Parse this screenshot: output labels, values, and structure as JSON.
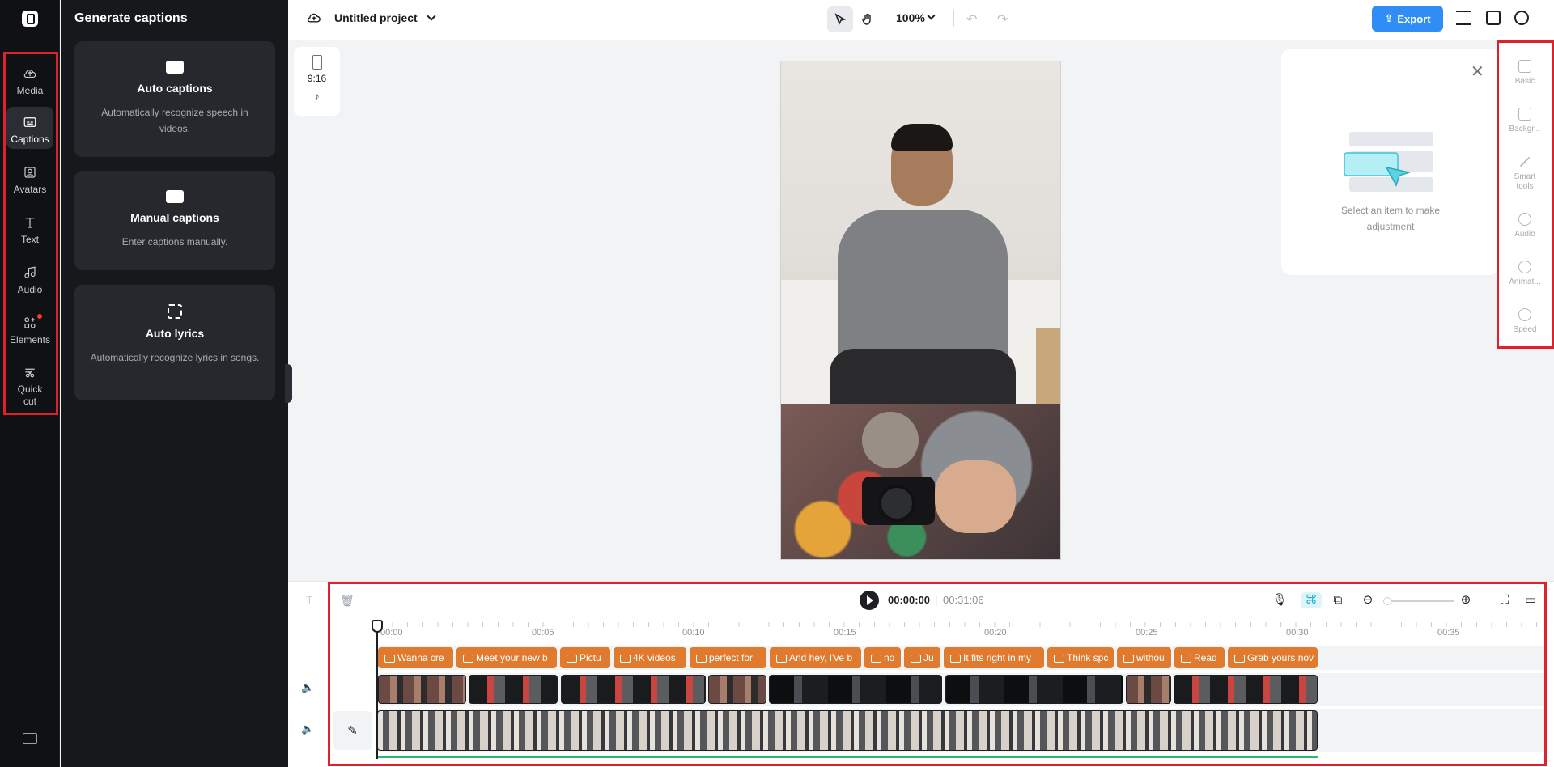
{
  "rail": {
    "items": [
      {
        "label": "Media"
      },
      {
        "label": "Captions"
      },
      {
        "label": "Avatars"
      },
      {
        "label": "Text"
      },
      {
        "label": "Audio"
      },
      {
        "label": "Elements"
      },
      {
        "label": "Quick cut"
      }
    ]
  },
  "panel": {
    "title": "Generate captions",
    "cards": [
      {
        "title": "Auto captions",
        "desc": "Automatically recognize speech in videos."
      },
      {
        "title": "Manual captions",
        "desc": "Enter captions manually."
      },
      {
        "title": "Auto lyrics",
        "desc": "Automatically recognize lyrics in songs."
      }
    ]
  },
  "topbar": {
    "project_title": "Untitled project",
    "zoom": "100%",
    "export_label": "Export"
  },
  "canvas": {
    "ratio": "9:16",
    "tiktok_icon": "♪"
  },
  "props_popup": {
    "hint": "Select an item to make adjustment"
  },
  "right_rail": {
    "items": [
      {
        "label": "Basic"
      },
      {
        "label": "Backgr..."
      },
      {
        "label": "Smart tools"
      },
      {
        "label": "Audio"
      },
      {
        "label": "Animat..."
      },
      {
        "label": "Speed"
      }
    ]
  },
  "timeline": {
    "current_time": "00:00:00",
    "separator": "|",
    "total_time": "00:31:06",
    "ticks": [
      "00:00",
      "00:05",
      "00:10",
      "00:15",
      "00:20",
      "00:25",
      "00:30",
      "00:35"
    ],
    "captions": [
      "Wanna cre",
      "Meet your new b",
      "Pictu",
      "4K videos",
      "perfect for",
      "And hey, I've b",
      "no",
      "Ju",
      "It fits right in my",
      "Think spc",
      "withou",
      "Read",
      "Grab yours nov"
    ]
  },
  "colors": {
    "accent": "#2f8df5",
    "caption_clip": "#e07a2e",
    "highlight_box": "#e0202a"
  }
}
